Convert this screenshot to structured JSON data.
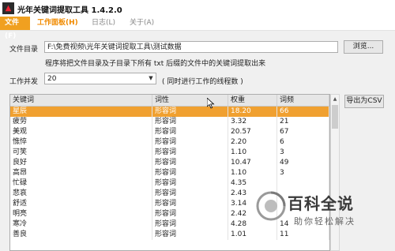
{
  "window": {
    "title": "光年关键词提取工具 1.4.2.0",
    "app_icon": "光年-logo-icon"
  },
  "menu": [
    {
      "label": "文件(F)",
      "state": "active"
    },
    {
      "label": "工作面板(H)",
      "state": "orange"
    },
    {
      "label": "日志(L)",
      "state": "normal"
    },
    {
      "label": "关于(A)",
      "state": "normal"
    }
  ],
  "form": {
    "dir_label": "文件目录",
    "dir_value": "F:\\免费视频\\光年关键词提取工具\\测试数据",
    "browse_label": "浏览...",
    "hint": "程序将把文件目录及子目录下所有 txt 后缀的文件中的关键词提取出来",
    "concurrency_label": "工作并发",
    "concurrency_value": "20",
    "concurrency_hint": "( 同时进行工作的线程数 )"
  },
  "table": {
    "columns": [
      "关键词",
      "词性",
      "权重",
      "词频"
    ],
    "rows": [
      [
        "星辰",
        "形容词",
        "18.20",
        "66"
      ],
      [
        "疲劳",
        "形容词",
        "3.32",
        "21"
      ],
      [
        "美观",
        "形容词",
        "20.57",
        "67"
      ],
      [
        "憔悴",
        "形容词",
        "2.20",
        "6"
      ],
      [
        "可笑",
        "形容词",
        "1.10",
        "3"
      ],
      [
        "良好",
        "形容词",
        "10.47",
        "49"
      ],
      [
        "高昂",
        "形容词",
        "1.10",
        "3"
      ],
      [
        "忙碌",
        "形容词",
        "4.35",
        ""
      ],
      [
        "悲哀",
        "形容词",
        "2.43",
        ""
      ],
      [
        "舒适",
        "形容词",
        "3.14",
        ""
      ],
      [
        "明亮",
        "形容词",
        "2.42",
        ""
      ],
      [
        "寒冷",
        "形容词",
        "4.28",
        "14"
      ],
      [
        "善良",
        "形容词",
        "1.01",
        "11"
      ]
    ],
    "selected_index": 0
  },
  "export_label": "导出为CSV",
  "watermark": {
    "title": "百科全说",
    "subtitle": "助你轻松解决"
  },
  "colors": {
    "accent": "#f0a020",
    "menu_orange": "#f08a00",
    "logo_red": "#e02020"
  }
}
